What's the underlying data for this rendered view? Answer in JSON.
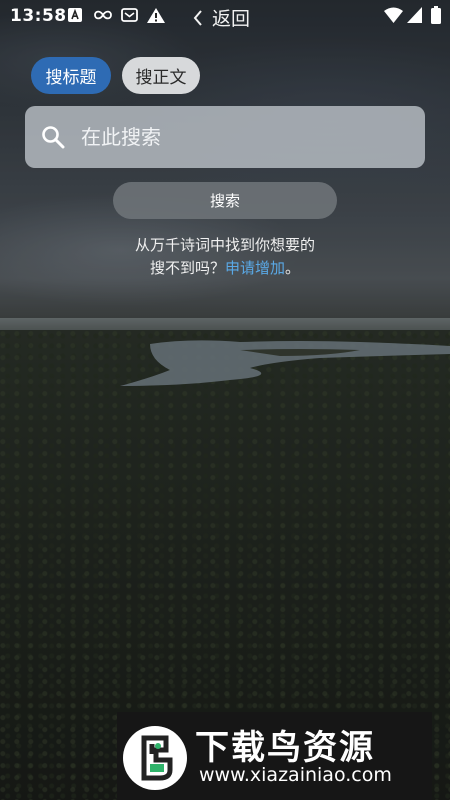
{
  "status_bar": {
    "time": "13:58",
    "icons": [
      "a-badge-icon",
      "infinity-icon",
      "message-icon",
      "warning-icon",
      "wifi-icon",
      "signal-icon",
      "battery-icon"
    ]
  },
  "header": {
    "back_label": "返回"
  },
  "tabs": [
    {
      "label": "搜标题",
      "selected": true
    },
    {
      "label": "搜正文",
      "selected": false
    }
  ],
  "search": {
    "placeholder": "在此搜索",
    "value": "",
    "button_label": "搜索"
  },
  "hint": {
    "line1": "从万千诗词中找到你想要的",
    "line2_prefix": "搜不到吗？",
    "line2_link": "申请增加",
    "line2_suffix": "。"
  },
  "watermark": {
    "title": "下载鸟资源",
    "url": "www.xiazainiao.com"
  },
  "colors": {
    "tab_selected": "#2e6bb4",
    "tab_unselected": "#d7d9db",
    "link": "#5aa9e6"
  }
}
